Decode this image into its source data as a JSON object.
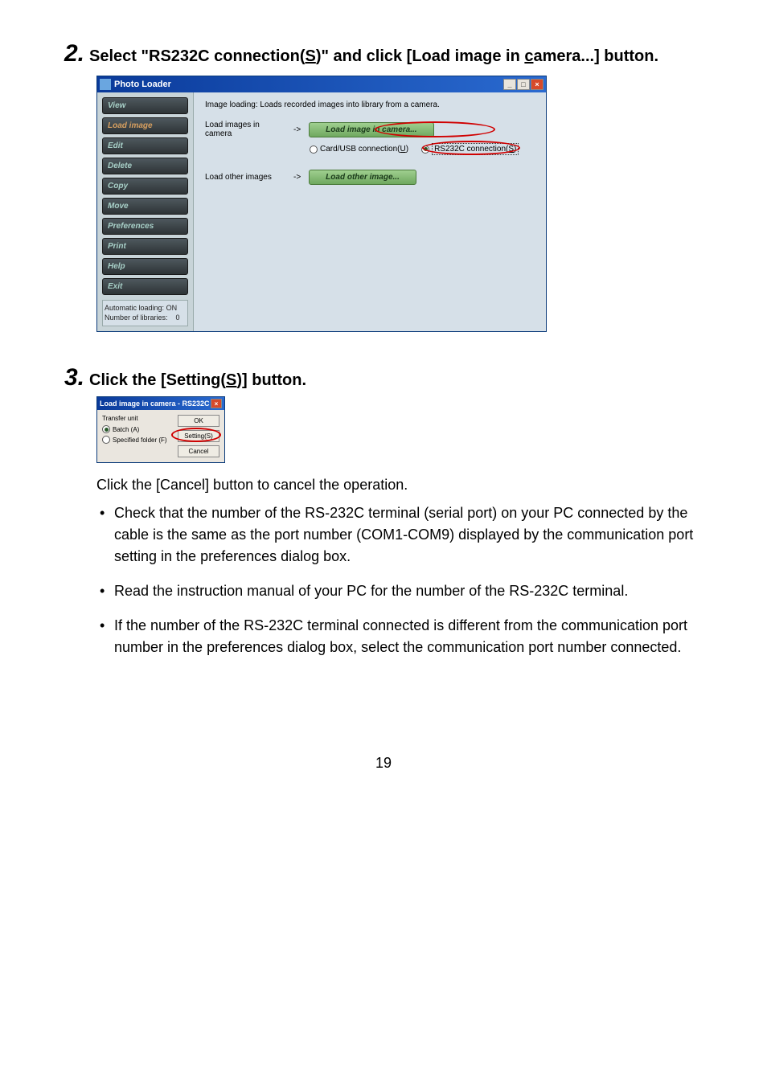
{
  "step2": {
    "num": "2.",
    "heading_a": "Select \"RS232C connection(",
    "heading_s": "S",
    "heading_b": ")\" and click [Load image in ",
    "heading_c_u": "c",
    "heading_d": "amera...] button."
  },
  "photo_loader": {
    "title": "Photo Loader",
    "sidebar": {
      "items": [
        "View",
        "Load image",
        "Edit",
        "Delete",
        "Copy",
        "Move",
        "Preferences",
        "Print",
        "Help",
        "Exit"
      ],
      "status_auto_label": "Automatic loading:",
      "status_auto_value": "ON",
      "status_lib_label": "Number of libraries:",
      "status_lib_value": "0"
    },
    "main": {
      "description": "Image loading: Loads recorded images into library from a camera.",
      "row1_label": "Load images in camera",
      "arrow": "->",
      "btn_load_camera": "Load image in camera...",
      "radio1_a": "Card/USB connection(",
      "radio1_u": "U",
      "radio1_b": ")",
      "radio2_a": "RS232C connection(",
      "radio2_u": "S",
      "radio2_b": ")",
      "row2_label": "Load other images",
      "btn_load_other": "Load other image..."
    }
  },
  "step3": {
    "num": "3.",
    "heading_a": "Click the [Setting(",
    "heading_s": "S",
    "heading_b": ")] button."
  },
  "dialog": {
    "title": "Load image in camera - RS232C",
    "transfer_label": "Transfer unit",
    "radio_batch": "Batch (A)",
    "radio_folder": "Specified folder (F)",
    "btn_ok": "OK",
    "btn_setting": "Setting(S)",
    "btn_cancel": "Cancel"
  },
  "body": {
    "cancel_line": "Click the [Cancel] button to cancel the operation.",
    "b1": "Check that the number of the RS-232C terminal (serial port) on your PC connected by the cable is the same as the port number (COM1-COM9) displayed by the communication port setting in the preferences dialog box.",
    "b2": "Read the instruction manual of your PC for the number of the RS-232C terminal.",
    "b3": "If the number of the RS-232C terminal connected is different from the communication port number in the preferences dialog box, select the communication port number connected."
  },
  "page_number": "19"
}
